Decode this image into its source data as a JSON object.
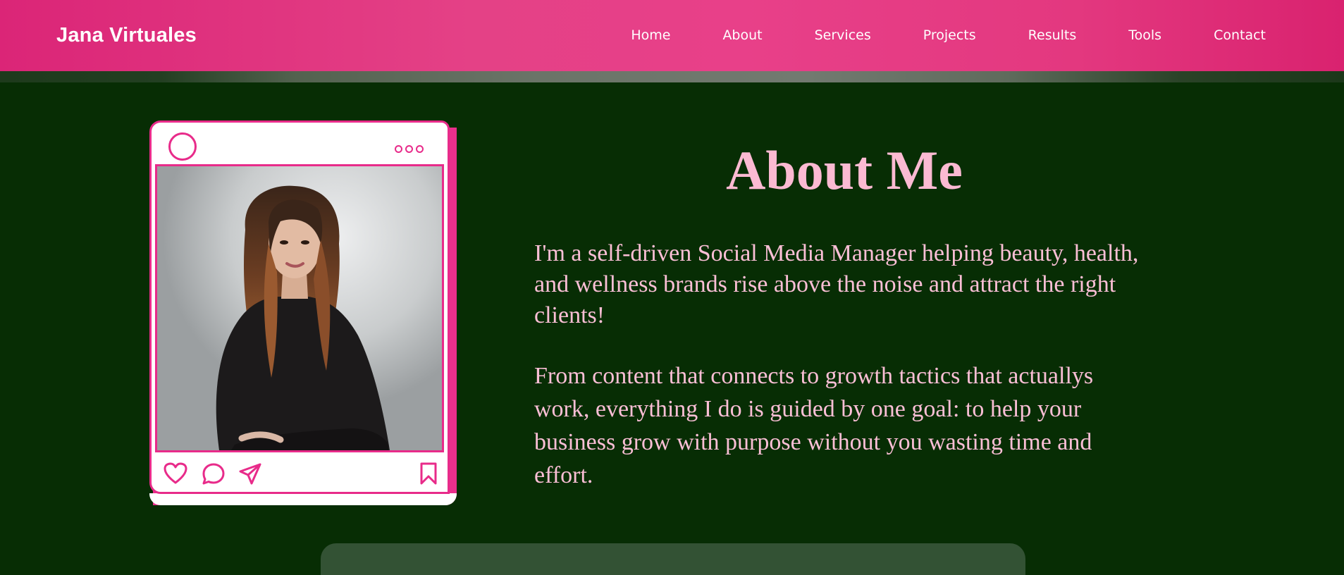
{
  "header": {
    "brand": "Jana Virtuales",
    "nav": [
      {
        "label": "Home"
      },
      {
        "label": "About"
      },
      {
        "label": "Services"
      },
      {
        "label": "Projects"
      },
      {
        "label": "Results"
      },
      {
        "label": "Tools"
      },
      {
        "label": "Contact"
      }
    ]
  },
  "about": {
    "title": "About Me",
    "paragraphs": [
      "I'm a self-driven Social Media Manager helping beauty, health, and wellness brands rise above the noise and attract the right clients!",
      "From content that connects to growth tactics that actuallys work, everything I do is guided by one goal: to help your business grow with purpose without you wasting time and effort."
    ]
  },
  "card": {
    "icons": [
      "profile-circle-icon",
      "more-dots-icon",
      "heart-icon",
      "comment-icon",
      "share-icon",
      "bookmark-icon"
    ]
  },
  "colors": {
    "accent": "#e82b8a",
    "background": "#072d04",
    "text_pink": "#fbbad2",
    "panel": "#335234"
  }
}
